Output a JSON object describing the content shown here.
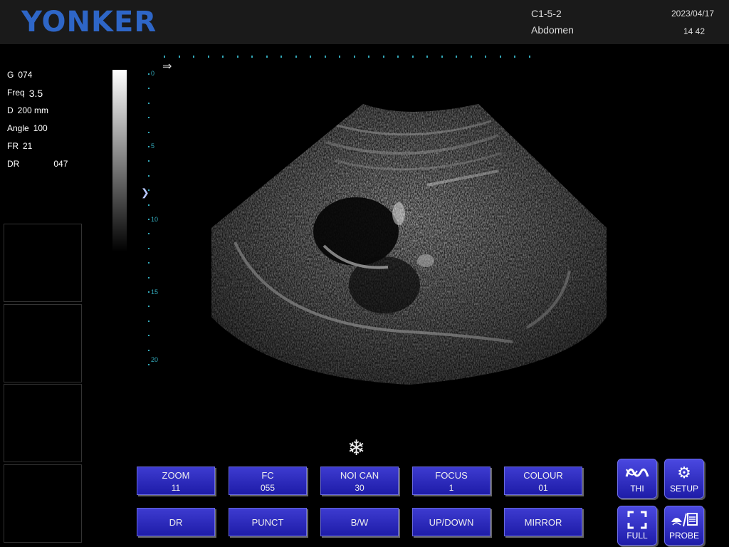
{
  "header": {
    "brand": "YONKER",
    "probe": "C1-5-2",
    "exam": "Abdomen",
    "date": "2023/04/17",
    "time": "14  42",
    "brand_color": "#2e66c7"
  },
  "params": [
    {
      "label": "G",
      "value": "074"
    },
    {
      "label": "Freq",
      "value": "3.5"
    },
    {
      "label": "D",
      "value": "200 mm"
    },
    {
      "label": "Angle",
      "value": "100"
    },
    {
      "label": "FR",
      "value": "21"
    },
    {
      "label": "DR",
      "value": "047"
    }
  ],
  "ruler": {
    "labels": [
      "0",
      "5",
      "10",
      "15",
      "20"
    ]
  },
  "freeze_icon": "snowflake-icon",
  "controls": {
    "row1": [
      {
        "label": "ZOOM",
        "value": "11"
      },
      {
        "label": "FC",
        "value": "055"
      },
      {
        "label": "NOI CAN",
        "value": "30"
      },
      {
        "label": "FOCUS",
        "value": "1"
      },
      {
        "label": "COLOUR",
        "value": "01"
      }
    ],
    "row2": [
      "DR",
      "PUNCT",
      "B/W",
      "UP/DOWN",
      "MIRROR"
    ]
  },
  "side_buttons": {
    "thi": "THI",
    "setup": "SETUP",
    "full": "FULL",
    "probe": "PROBE"
  },
  "colors": {
    "button": "#2a28c0",
    "ruler": "#33aabb"
  }
}
